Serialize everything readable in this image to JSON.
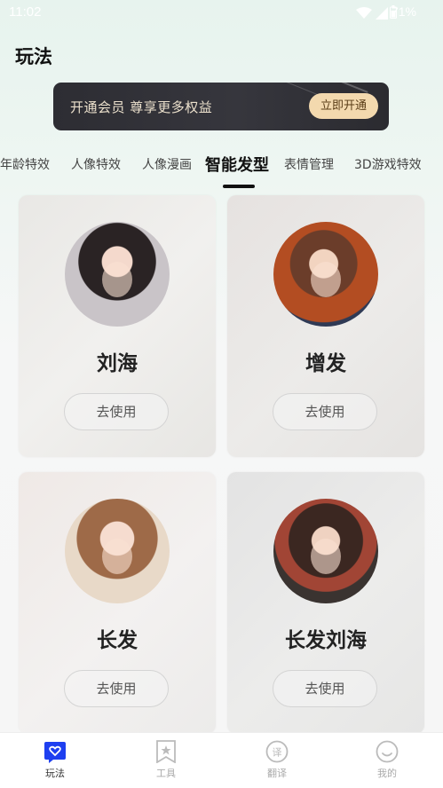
{
  "status_bar": {
    "time": "11:02",
    "battery": "71%"
  },
  "page": {
    "title": "玩法"
  },
  "vip_banner": {
    "text": "开通会员 尊享更多权益",
    "button": "立即开通"
  },
  "tabs": [
    {
      "label": "年龄特效",
      "active": false
    },
    {
      "label": "人像特效",
      "active": false
    },
    {
      "label": "人像漫画",
      "active": false
    },
    {
      "label": "智能发型",
      "active": true
    },
    {
      "label": "表情管理",
      "active": false
    },
    {
      "label": "3D游戏特效",
      "active": false
    }
  ],
  "cards": [
    {
      "title": "刘海",
      "button": "去使用"
    },
    {
      "title": "增发",
      "button": "去使用"
    },
    {
      "title": "长发",
      "button": "去使用"
    },
    {
      "title": "长发刘海",
      "button": "去使用"
    }
  ],
  "bottom_nav": [
    {
      "label": "玩法",
      "icon": "heart-chat-icon",
      "active": true
    },
    {
      "label": "工具",
      "icon": "bookmark-star-icon",
      "active": false
    },
    {
      "label": "翻译",
      "icon": "translate-icon",
      "active": false
    },
    {
      "label": "我的",
      "icon": "smiley-icon",
      "active": false
    }
  ],
  "colors": {
    "accent": "#1e3ff0",
    "vip_gold": "#f3d9ae"
  }
}
